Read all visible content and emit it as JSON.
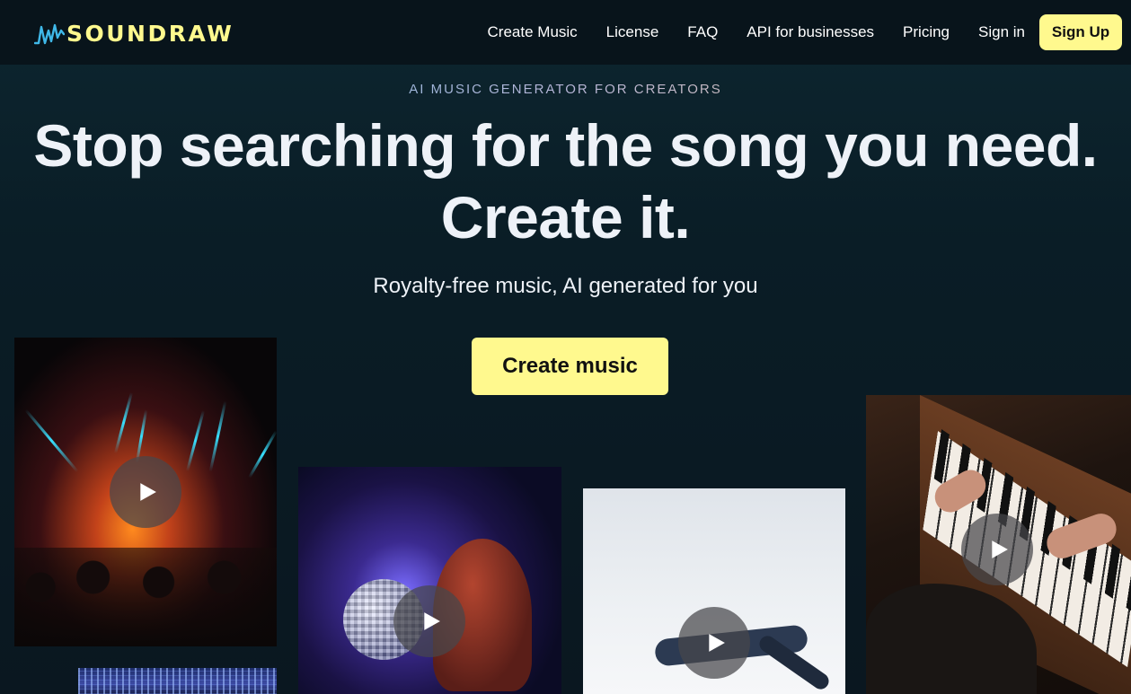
{
  "brand": {
    "name": "SOUNDRAW",
    "accent": "#fff98e"
  },
  "nav": {
    "links": [
      "Create Music",
      "License",
      "FAQ",
      "API for businesses",
      "Pricing",
      "Sign in"
    ],
    "signup_label": "Sign Up"
  },
  "hero": {
    "eyebrow": "AI MUSIC GENERATOR FOR CREATORS",
    "headline_line1": "Stop searching for the song you need.",
    "headline_line2": "Create it.",
    "subhead": "Royalty-free music, AI generated for you",
    "cta_label": "Create music"
  },
  "cards": [
    {
      "name": "concert-card",
      "icon": "play-icon"
    },
    {
      "name": "disco-card",
      "icon": "play-icon"
    },
    {
      "name": "dancer-card",
      "icon": "play-icon"
    },
    {
      "name": "piano-card",
      "icon": "play-icon"
    },
    {
      "name": "city-card"
    }
  ]
}
